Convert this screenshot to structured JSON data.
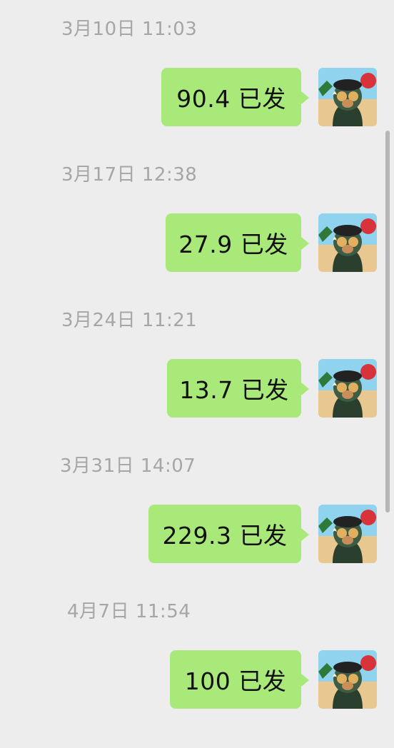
{
  "messages": [
    {
      "timestamp": "3月10日 11:03",
      "text": "90.4 已发"
    },
    {
      "timestamp": "3月17日 12:38",
      "text": "27.9 已发"
    },
    {
      "timestamp": "3月24日 11:21",
      "text": "13.7 已发"
    },
    {
      "timestamp": "3月31日 14:07",
      "text": "229.3 已发"
    },
    {
      "timestamp": "4月7日 11:54",
      "text": "100 已发"
    }
  ],
  "colors": {
    "background": "#ededed",
    "bubble": "#a9e97a",
    "timestamp_text": "#a6a6a6"
  },
  "icons": {
    "avatar": "cartoon-character-avatar-icon"
  }
}
